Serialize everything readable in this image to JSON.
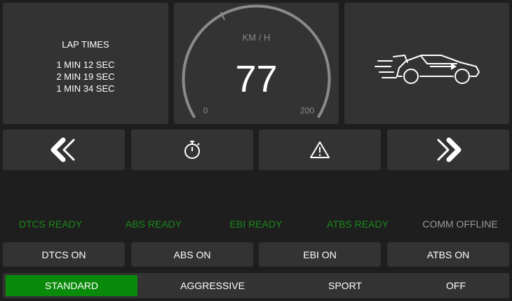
{
  "lap_times": {
    "title": "LAP TIMES",
    "times": [
      "1 MIN 12 SEC",
      "2 MIN 19 SEC",
      "1 MIN 34 SEC"
    ]
  },
  "speedometer": {
    "unit": "KM / H",
    "value": "77",
    "min_label": "0",
    "max_label": "200",
    "max": 200
  },
  "car_icon": "car-speed-icon",
  "nav_buttons": [
    {
      "icon": "double-chevron-left-icon"
    },
    {
      "icon": "stopwatch-icon"
    },
    {
      "icon": "warning-triangle-icon"
    },
    {
      "icon": "double-chevron-right-icon"
    }
  ],
  "statuses": [
    {
      "label": "DTCS READY",
      "state": "ready"
    },
    {
      "label": "ABS READY",
      "state": "ready"
    },
    {
      "label": "EBI READY",
      "state": "ready"
    },
    {
      "label": "ATBS READY",
      "state": "ready"
    },
    {
      "label": "COMM OFFLINE",
      "state": "offline"
    }
  ],
  "system_buttons": [
    "DTCS ON",
    "ABS ON",
    "EBI ON",
    "ATBS ON"
  ],
  "modes": [
    {
      "label": "STANDARD",
      "active": true
    },
    {
      "label": "AGGRESSIVE",
      "active": false
    },
    {
      "label": "SPORT",
      "active": false
    },
    {
      "label": "OFF",
      "active": false
    }
  ],
  "colors": {
    "background": "#1e1e1e",
    "panel": "#333333",
    "ready": "#1a8a1a",
    "offline": "#9a9a9a",
    "active_mode": "#0a8a0a"
  }
}
